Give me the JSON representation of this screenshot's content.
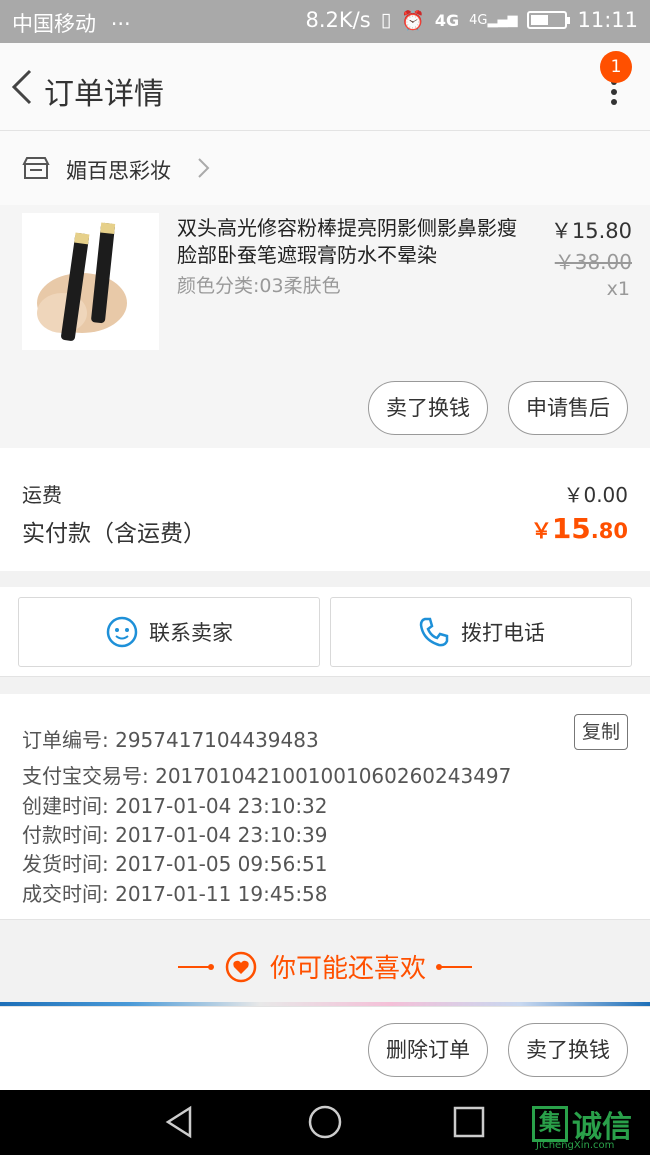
{
  "status_bar": {
    "carrier": "中国移动",
    "extra": "···",
    "speed": "8.2K/s",
    "network": "4G",
    "network2": "4G",
    "time": "11:11"
  },
  "header": {
    "title": "订单详情",
    "badge_count": "1"
  },
  "shop": {
    "name": "媚百思彩妆"
  },
  "product": {
    "title": "双头高光修容粉棒提亮阴影侧影鼻影瘦脸部卧蚕笔遮瑕膏防水不晕染",
    "spec": "颜色分类:03柔肤色",
    "price": "￥15.80",
    "original_price": "￥38.00",
    "quantity": "x1",
    "actions": [
      "卖了换钱",
      "申请售后"
    ]
  },
  "totals": {
    "shipping_label": "运费",
    "shipping_value": "￥0.00",
    "paid_label": "实付款（含运费）",
    "paid_symbol": "￥",
    "paid_int": "15",
    "paid_dec": ".80"
  },
  "contact": {
    "seller": "联系卖家",
    "call": "拨打电话"
  },
  "order_info": {
    "copy_label": "复制",
    "rows": [
      "订单编号: 2957417104439483",
      "支付宝交易号: 2017010421001001060260243497",
      "创建时间: 2017-01-04 23:10:32",
      "付款时间: 2017-01-04 23:10:39",
      "发货时间: 2017-01-05 09:56:51",
      "成交时间: 2017-01-11 19:45:58"
    ]
  },
  "recommend": {
    "label": "你可能还喜欢"
  },
  "bottom_actions": [
    "删除订单",
    "卖了换钱"
  ],
  "watermark": {
    "box_char": "集",
    "brand": "诚信",
    "site": "JiChengXin.com"
  },
  "colors": {
    "accent": "#ff5000",
    "statusbar": "#a9a9a9",
    "icon_blue": "#1e90d8"
  }
}
